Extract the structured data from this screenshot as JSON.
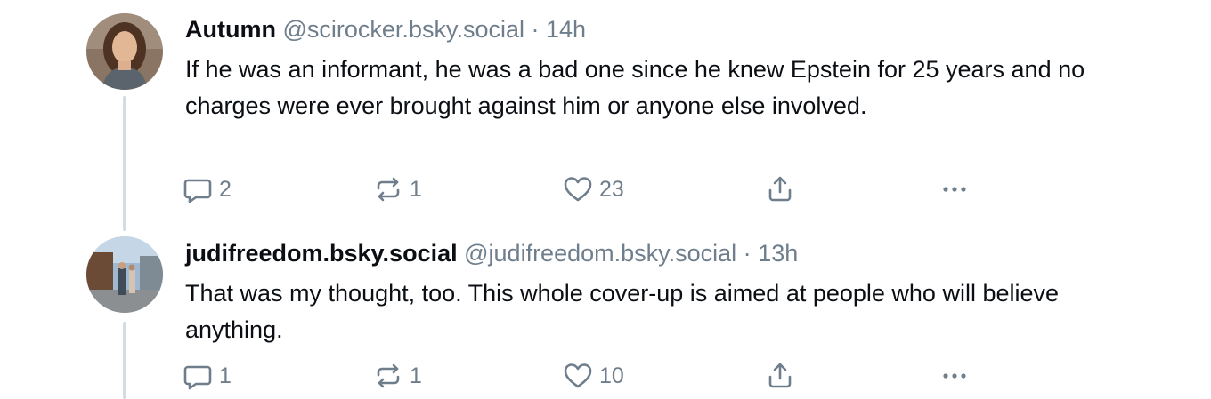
{
  "posts": [
    {
      "author": "Autumn",
      "handle": "@scirocker.bsky.social",
      "separator": "·",
      "time": "14h",
      "text": "If he was an informant, he was a bad one since he knew Epstein for 25 years and no charges were ever brought against him or anyone else involved.",
      "replies": "2",
      "reposts": "1",
      "likes": "23"
    },
    {
      "author": "judifreedom.bsky.social",
      "handle": "@judifreedom.bsky.social",
      "separator": "·",
      "time": "13h",
      "text": "That was my thought, too. This whole cover-up is aimed at people who will believe anything.",
      "replies": "1",
      "reposts": "1",
      "likes": "10"
    }
  ],
  "icons": {
    "reply": "reply-icon",
    "repost": "repost-icon",
    "like": "heart-icon",
    "share": "share-icon",
    "more": "more-icon"
  },
  "colors": {
    "text": "#0b0f14",
    "muted": "#6f7e8c",
    "thread_line": "#d4dbe2"
  }
}
